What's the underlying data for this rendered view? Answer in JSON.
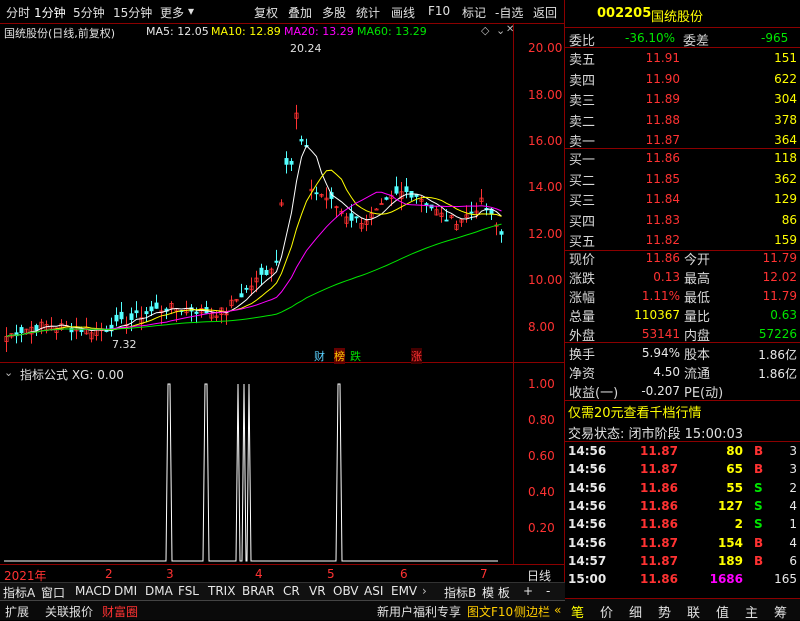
{
  "toolbar": {
    "periods": [
      "分时",
      "1分钟",
      "5分钟",
      "15分钟",
      "更多"
    ],
    "actions": [
      "复权",
      "叠加",
      "多股",
      "统计",
      "画线",
      "F10",
      "标记",
      "-自选",
      "返回"
    ]
  },
  "chart_header": {
    "stock": "国统股份(日线,前复权)",
    "ma5": "MA5: 12.05",
    "ma10": "MA10: 12.89",
    "ma20": "MA20: 13.29",
    "ma60": "MA60: 13.29"
  },
  "price_axis": [
    "20.00",
    "18.00",
    "16.00",
    "14.00",
    "12.00",
    "10.00",
    "8.00"
  ],
  "annotations": {
    "high": "20.24",
    "low": "7.32"
  },
  "markers": {
    "cai": "财",
    "bang": "榜",
    "die": "跌",
    "zhang": "涨"
  },
  "indicator": {
    "title": "指标公式 XG: 0.00",
    "axis": [
      "1.00",
      "0.80",
      "0.60",
      "0.40",
      "0.20"
    ]
  },
  "date_axis": {
    "year": "2021年",
    "months": [
      "2",
      "3",
      "4",
      "5",
      "6",
      "7"
    ],
    "period": "日线"
  },
  "indicator_tabs": [
    "指标A",
    "窗口",
    "MACD",
    "DMI",
    "DMA",
    "FSL",
    "TRIX",
    "BRAR",
    "CR",
    "VR",
    "OBV",
    "ASI",
    "EMV",
    "指标B",
    "模 板",
    "+",
    "-"
  ],
  "status_bar": {
    "left": [
      "扩展",
      "关联报价",
      "财富圈"
    ],
    "promo": "新用户福利专享",
    "f10": "图文F10",
    "side": "侧边栏"
  },
  "quote": {
    "code": "002205",
    "name": "国统股份",
    "webi_label": "委比",
    "webi": "-36.10%",
    "weicha_label": "委差",
    "weicha": "-965",
    "asks": [
      {
        "label": "卖五",
        "price": "11.91",
        "vol": "151"
      },
      {
        "label": "卖四",
        "price": "11.90",
        "vol": "622"
      },
      {
        "label": "卖三",
        "price": "11.89",
        "vol": "304"
      },
      {
        "label": "卖二",
        "price": "11.88",
        "vol": "378"
      },
      {
        "label": "卖一",
        "price": "11.87",
        "vol": "364"
      }
    ],
    "bids": [
      {
        "label": "买一",
        "price": "11.86",
        "vol": "118"
      },
      {
        "label": "买二",
        "price": "11.85",
        "vol": "362"
      },
      {
        "label": "买三",
        "price": "11.84",
        "vol": "129"
      },
      {
        "label": "买四",
        "price": "11.83",
        "vol": "86"
      },
      {
        "label": "买五",
        "price": "11.82",
        "vol": "159"
      }
    ],
    "stats": [
      {
        "l1": "现价",
        "v1": "11.86",
        "l2": "今开",
        "v2": "11.79"
      },
      {
        "l1": "涨跌",
        "v1": "0.13",
        "l2": "最高",
        "v2": "12.02"
      },
      {
        "l1": "涨幅",
        "v1": "1.11%",
        "l2": "最低",
        "v2": "11.79"
      },
      {
        "l1": "总量",
        "v1": "110367",
        "l2": "量比",
        "v2": "0.63"
      },
      {
        "l1": "外盘",
        "v1": "53141",
        "l2": "内盘",
        "v2": "57226"
      }
    ],
    "fin": [
      {
        "l1": "换手",
        "v1": "5.94%",
        "l2": "股本",
        "v2": "1.86亿"
      },
      {
        "l1": "净资",
        "v1": "4.50",
        "l2": "流通",
        "v2": "1.86亿"
      },
      {
        "l1": "收益(一)",
        "v1": "-0.207",
        "l2": "PE(动)",
        "v2": ""
      }
    ],
    "promo": "仅需20元查看千档行情",
    "trade_status": "交易状态: 闭市阶段 15:00:03",
    "ticks": [
      {
        "t": "14:56",
        "p": "11.87",
        "v": "80",
        "s": "B",
        "n": "3"
      },
      {
        "t": "14:56",
        "p": "11.87",
        "v": "65",
        "s": "B",
        "n": "3"
      },
      {
        "t": "14:56",
        "p": "11.86",
        "v": "55",
        "s": "S",
        "n": "2"
      },
      {
        "t": "14:56",
        "p": "11.86",
        "v": "127",
        "s": "S",
        "n": "4"
      },
      {
        "t": "14:56",
        "p": "11.86",
        "v": "2",
        "s": "S",
        "n": "1"
      },
      {
        "t": "14:56",
        "p": "11.87",
        "v": "154",
        "b": "",
        "s": "B",
        "n": "4"
      },
      {
        "t": "14:57",
        "p": "11.87",
        "v": "189",
        "s": "B",
        "n": "6"
      },
      {
        "t": "15:00",
        "p": "11.86",
        "v": "1686",
        "s": "",
        "n": "165"
      }
    ],
    "bottom_tabs": [
      "笔",
      "价",
      "细",
      "势",
      "联",
      "值",
      "主",
      "筹"
    ]
  }
}
